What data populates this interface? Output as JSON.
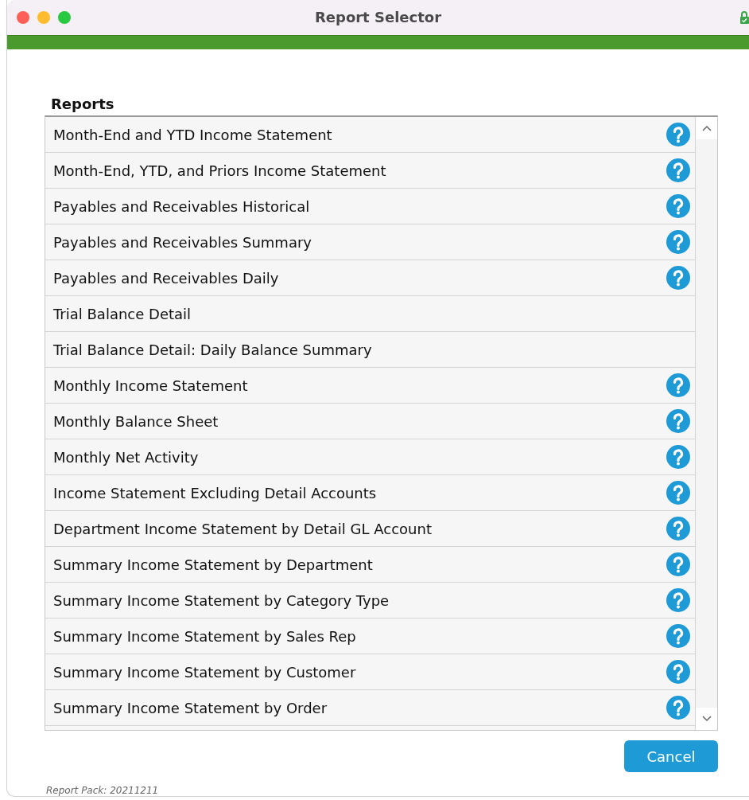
{
  "window": {
    "title": "Report Selector"
  },
  "reports": {
    "heading": "Reports",
    "rows": [
      {
        "label": "Month-End and YTD Income Statement",
        "help": true
      },
      {
        "label": "Month-End, YTD, and Priors Income Statement",
        "help": true
      },
      {
        "label": "Payables and Receivables Historical",
        "help": true
      },
      {
        "label": "Payables and Receivables Summary",
        "help": true
      },
      {
        "label": "Payables and Receivables Daily",
        "help": true
      },
      {
        "label": "Trial Balance Detail",
        "help": false
      },
      {
        "label": "Trial Balance Detail: Daily Balance Summary",
        "help": false
      },
      {
        "label": "Monthly Income Statement",
        "help": true
      },
      {
        "label": "Monthly Balance Sheet",
        "help": true
      },
      {
        "label": "Monthly Net Activity",
        "help": true
      },
      {
        "label": "Income Statement Excluding Detail Accounts",
        "help": true
      },
      {
        "label": "Department Income Statement by Detail GL Account",
        "help": true
      },
      {
        "label": "Summary Income Statement by Department",
        "help": true
      },
      {
        "label": "Summary Income Statement by Category Type",
        "help": true
      },
      {
        "label": "Summary Income Statement by Sales Rep",
        "help": true
      },
      {
        "label": "Summary Income Statement by Customer",
        "help": true
      },
      {
        "label": "Summary Income Statement by Order",
        "help": true
      }
    ]
  },
  "buttons": [
    "Cancel"
  ],
  "footer": "Report Pack: 20211211"
}
